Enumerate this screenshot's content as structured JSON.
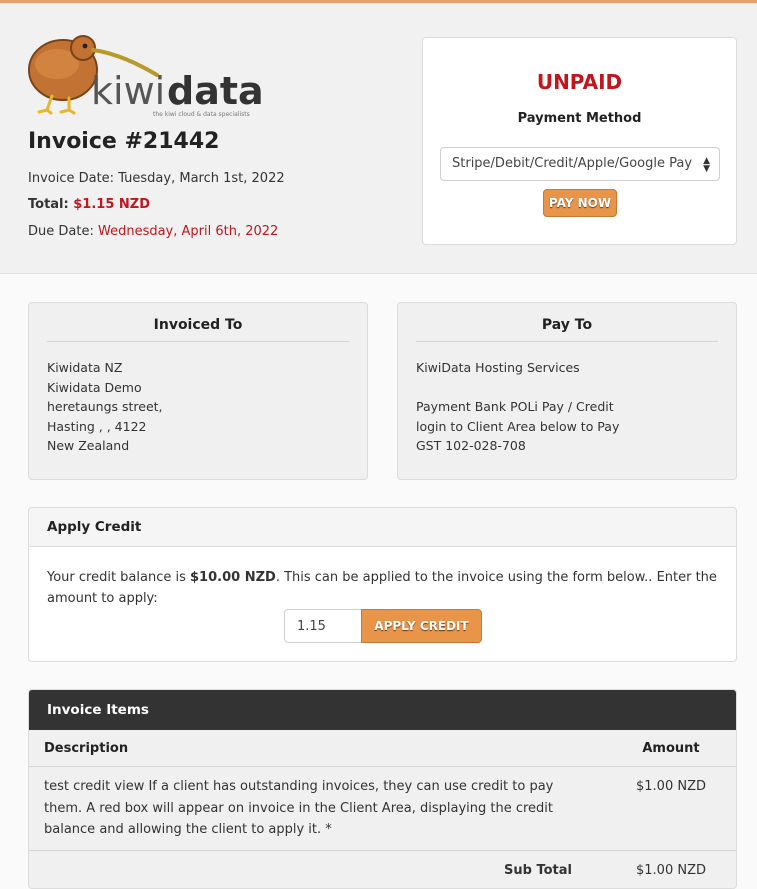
{
  "brand": {
    "logo_text_light": "kiwi",
    "logo_text_bold": "data",
    "tagline": "the kiwi cloud & data specialists",
    "accent": "#e8954a",
    "danger": "#c0161e"
  },
  "invoice": {
    "title": "Invoice #21442",
    "date_label": "Invoice Date:",
    "date_value": "Tuesday, March 1st, 2022",
    "total_label": "Total:",
    "total_value": "$1.15 NZD",
    "due_label": "Due Date:",
    "due_value": "Wednesday, April 6th, 2022"
  },
  "payment": {
    "status": "UNPAID",
    "method_label": "Payment Method",
    "selected_method": "Stripe/Debit/Credit/Apple/Google Pay",
    "pay_button": "PAY NOW"
  },
  "invoiced_to": {
    "title": "Invoiced To",
    "lines": [
      "Kiwidata NZ",
      "Kiwidata Demo",
      "heretaungs street,",
      "Hasting , , 4122",
      "New Zealand"
    ]
  },
  "pay_to": {
    "title": "Pay To",
    "lines": [
      "KiwiData Hosting Services",
      "",
      "Payment Bank POLi Pay / Credit",
      "login to Client Area below to Pay",
      "GST 102-028-708"
    ]
  },
  "credit": {
    "title": "Apply Credit",
    "text_before": "Your credit balance is ",
    "balance": "$10.00 NZD",
    "text_after": ". This can be applied to the invoice using the form below.. Enter the amount to apply:",
    "amount_value": "1.15",
    "button": "APPLY CREDIT"
  },
  "items": {
    "title": "Invoice Items",
    "col_description": "Description",
    "col_amount": "Amount",
    "rows": [
      {
        "description": "test credit view If a client has outstanding invoices, they can use credit to pay them. A red box will appear on invoice in the Client Area, displaying the credit balance and allowing the client to apply it. *",
        "amount": "$1.00 NZD"
      }
    ],
    "subtotal_label": "Sub Total",
    "subtotal_value": "$1.00 NZD"
  }
}
